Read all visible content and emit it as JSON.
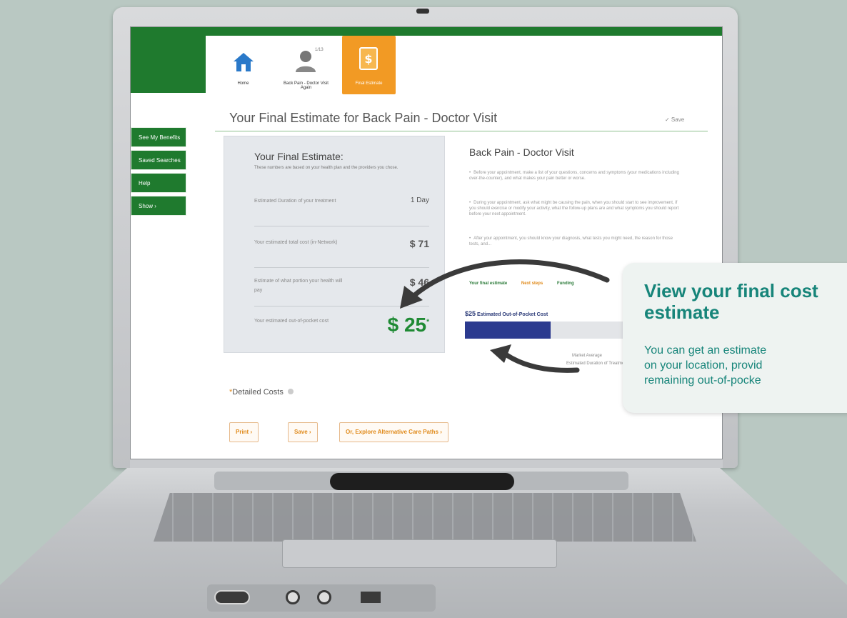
{
  "app": {
    "breadcrumb": [
      {
        "label": "Home",
        "icon": "home-icon",
        "count": ""
      },
      {
        "label": "Back Pain - Doctor Visit Again",
        "icon": "person-icon",
        "count": "1/13"
      },
      {
        "label": "Final Estimate",
        "icon": "dollar-document-icon",
        "count": ""
      }
    ],
    "sidebar": {
      "items": [
        {
          "label": "See My Benefits"
        },
        {
          "label": "Saved Searches"
        },
        {
          "label": "Help"
        },
        {
          "label": "Show  ›"
        }
      ]
    },
    "page_title": "Your Final Estimate for Back Pain - Doctor Visit",
    "save_link": "✓ Save",
    "estimate": {
      "heading": "Your Final Estimate:",
      "subtext": "These numbers are based on your health plan and the providers you chose.",
      "rows": [
        {
          "label": "Estimated Duration of your treatment",
          "value": "1 Day"
        },
        {
          "label": "Your estimated total cost (in-Network)",
          "value": "$ 71"
        },
        {
          "label": "Estimate of what portion your health will pay",
          "value": "$ 46"
        },
        {
          "label": "Your estimated out-of-pocket cost",
          "value": "$ 25"
        }
      ],
      "final_marker": "*"
    },
    "detail": {
      "heading": "Back Pain - Doctor Visit",
      "bullets": [
        "Before your appointment, make a list of your questions, concerns and symptoms (your medications including over-the-counter), and what makes your pain better or worse.",
        "During your appointment, ask what might be causing the pain, when you should start to see improvement, if you should exercise or modify your activity, what the follow-up plans are and what symptoms you should report before your next appointment.",
        "After your appointment, you should know your diagnosis, what tests you might need, the reason for those tests, and..."
      ],
      "tabs": [
        "Your final estimate",
        "Next steps",
        "Funding"
      ],
      "oop_amount": "$25",
      "oop_label": "Estimated Out-of-Pocket Cost",
      "oop_fraction": 0.4,
      "market_text": "Market Average",
      "market_text2": "Estimated Duration of Treatment"
    },
    "detailed_costs": {
      "marker": "*",
      "label": "Detailed Costs"
    },
    "buttons": {
      "print": "Print ›",
      "save": "Save ›",
      "explore": "Or, Explore Alternative Care Paths ›"
    }
  },
  "callout": {
    "title": "View your final cost estimate",
    "body": "You can get an estimate\non your location, provid\nremaining out-of-pocke"
  },
  "colors": {
    "brand_green": "#1f7a2e",
    "accent_orange": "#f29a24",
    "callout_teal": "#17857a",
    "bar_navy": "#2b3a8f"
  }
}
